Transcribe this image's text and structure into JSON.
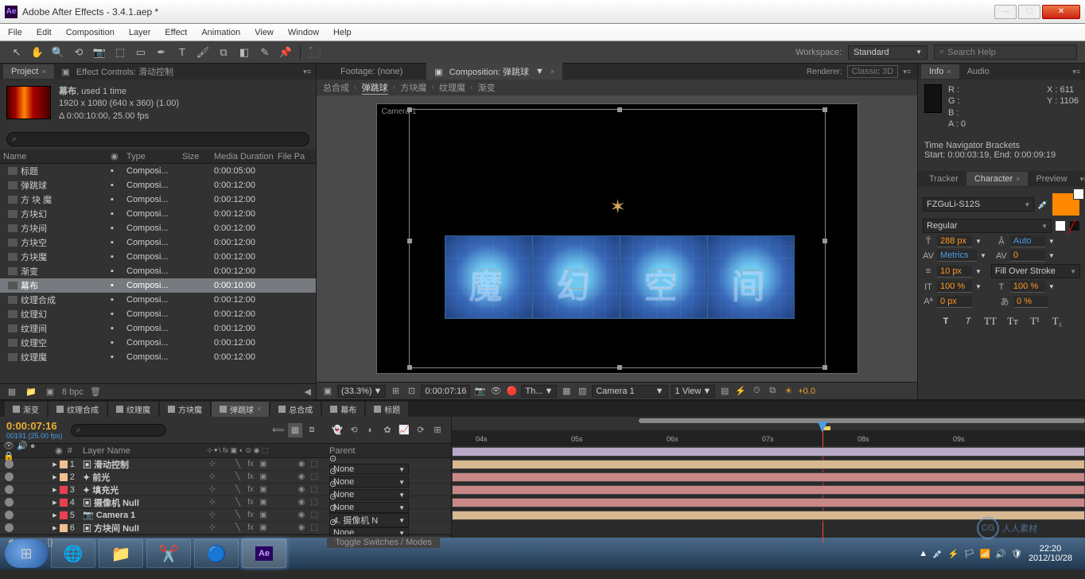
{
  "window": {
    "title": "Adobe After Effects - 3.4.1.aep *"
  },
  "menu": [
    "File",
    "Edit",
    "Composition",
    "Layer",
    "Effect",
    "Animation",
    "View",
    "Window",
    "Help"
  ],
  "workspace": {
    "label": "Workspace:",
    "value": "Standard",
    "search_ph": "Search Help"
  },
  "project": {
    "tab": "Project",
    "effect_tab": "Effect Controls: 滑动控制",
    "item_name": "幕布",
    "item_meta1": ", used 1 time",
    "item_meta2": "1920 x 1080  (640 x 360) (1.00)",
    "item_meta3": "Δ 0:00:10:00, 25.00 fps",
    "search_ph": "⌕",
    "cols": {
      "name": "Name",
      "type": "Type",
      "size": "Size",
      "dur": "Media Duration",
      "fp": "File Pa"
    },
    "rows": [
      {
        "name": "标题",
        "type": "Composi...",
        "dur": "0:00:05:00"
      },
      {
        "name": "弹跳球",
        "type": "Composi...",
        "dur": "0:00:12:00"
      },
      {
        "name": "方 块  魔",
        "type": "Composi...",
        "dur": "0:00:12:00"
      },
      {
        "name": "方块幻",
        "type": "Composi...",
        "dur": "0:00:12:00"
      },
      {
        "name": "方块间",
        "type": "Composi...",
        "dur": "0:00:12:00"
      },
      {
        "name": "方块空",
        "type": "Composi...",
        "dur": "0:00:12:00"
      },
      {
        "name": "方块魔",
        "type": "Composi...",
        "dur": "0:00:12:00"
      },
      {
        "name": "渐变",
        "type": "Composi...",
        "dur": "0:00:12:00"
      },
      {
        "name": "幕布",
        "type": "Composi...",
        "dur": "0:00:10:00",
        "sel": true
      },
      {
        "name": "纹理合成",
        "type": "Composi...",
        "dur": "0:00:12:00"
      },
      {
        "name": "纹理幻",
        "type": "Composi...",
        "dur": "0:00:12:00"
      },
      {
        "name": "纹理间",
        "type": "Composi...",
        "dur": "0:00:12:00"
      },
      {
        "name": "纹理空",
        "type": "Composi...",
        "dur": "0:00:12:00"
      },
      {
        "name": "纹理魔",
        "type": "Composi...",
        "dur": "0:00:12:00"
      }
    ],
    "bpc": "8 bpc"
  },
  "comp": {
    "footage_tab": "Footage: (none)",
    "comp_tab": "Composition: 弹跳球",
    "breadcrumb": [
      "总合成",
      "弹跳球",
      "方块魔",
      "纹理魔",
      "渐变"
    ],
    "renderer_label": "Renderer:",
    "renderer_value": "Classic 3D",
    "camera": "Camera 1",
    "footer": {
      "zoom": "(33.3%)",
      "timecode": "0:00:07:16",
      "camera": "Camera 1",
      "view": "1 View",
      "exposure": "+0.0"
    },
    "tiles": [
      "魔",
      "幻",
      "空",
      "间"
    ]
  },
  "info": {
    "tabs": [
      "Info",
      "Audio"
    ],
    "r": "R :",
    "g": "G :",
    "b": "B :",
    "a": "A : 0",
    "x": "X : 611",
    "y": "Y : 1106",
    "nav": "Time Navigator Brackets",
    "nav2": "Start: 0:00:03:19, End: 0:00:09:19"
  },
  "char": {
    "tabs": [
      "Tracker",
      "Character",
      "Preview"
    ],
    "font": "FZGuLi-S12S",
    "style": "Regular",
    "size": "288",
    "size_u": "px",
    "leading": "Auto",
    "kern": "Metrics",
    "track": "0",
    "stroke": "10",
    "stroke_u": "px",
    "fill_opt": "Fill Over Stroke",
    "vscale": "100",
    "hscale": "100",
    "pct": "%",
    "baseline": "0",
    "baseline_u": "px",
    "tsumi": "0",
    "tsumi_pct": "%"
  },
  "timeline": {
    "tabs": [
      "渐变",
      "纹理合成",
      "纹理魔",
      "方块魔",
      "弹跳球",
      "总合成",
      "幕布",
      "标题"
    ],
    "active_tab": 4,
    "timecode": "0:00:07:16",
    "frame": "00191 (25.00 fps)",
    "cols": {
      "num": "#",
      "name": "Layer Name",
      "parent": "Parent"
    },
    "layers": [
      {
        "n": "1",
        "color": "#f0c090",
        "name": "滑动控制",
        "icon": "▣",
        "parent": "None",
        "bar": "#b8a8c8"
      },
      {
        "n": "2",
        "color": "#f0c090",
        "name": "前光",
        "icon": "✦",
        "parent": "None",
        "bar": "#d8b890"
      },
      {
        "n": "3",
        "color": "#e84050",
        "name": "填充光",
        "icon": "✦",
        "parent": "None",
        "bar": "#c88888"
      },
      {
        "n": "4",
        "color": "#e84050",
        "name": "摄像机 Null",
        "icon": "▣",
        "parent": "None",
        "bar": "#c88888"
      },
      {
        "n": "5",
        "color": "#e84050",
        "name": "Camera 1",
        "icon": "📷",
        "parent": "4. 摄像机  N",
        "bar": "#c88888"
      },
      {
        "n": "6",
        "color": "#f0c090",
        "name": "方块间 Null",
        "icon": "▣",
        "parent": "None",
        "bar": "#d8b890"
      }
    ],
    "toggle": "Toggle Switches / Modes",
    "ruler": [
      "04s",
      "05s",
      "06s",
      "07s",
      "08s",
      "09s"
    ]
  },
  "taskbar": {
    "time": "22:20",
    "date": "2012/10/28"
  },
  "watermark": "人人素材"
}
